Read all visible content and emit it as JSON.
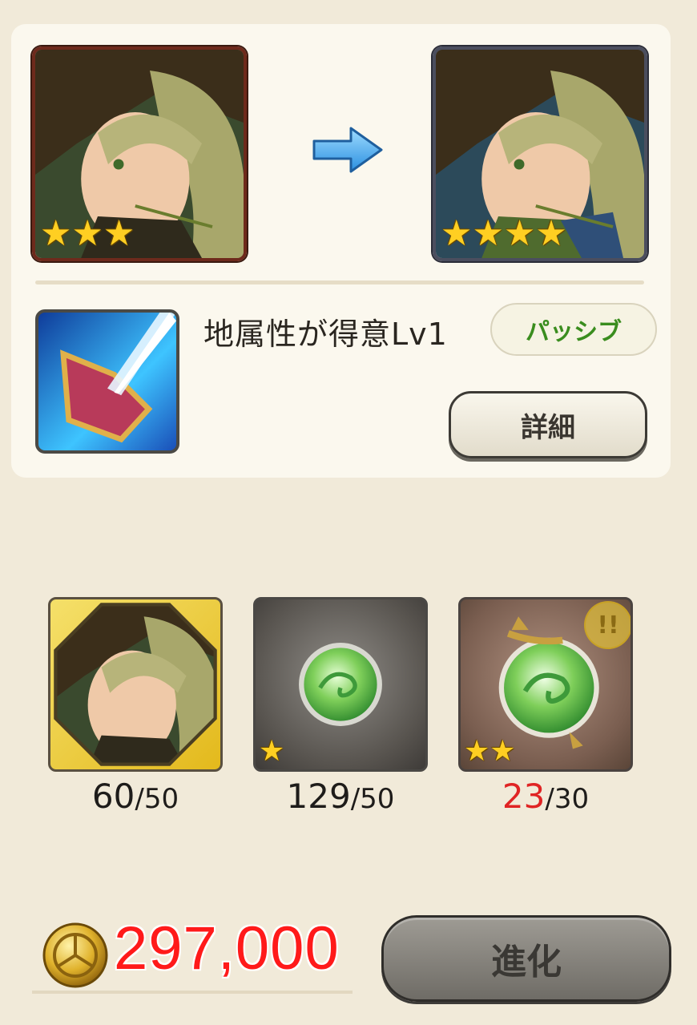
{
  "evolution": {
    "before": {
      "character": "green-haired-witch-portrait",
      "stars": "★★★",
      "rarity": 3
    },
    "after": {
      "character": "green-haired-witch-portrait",
      "stars": "★★★★",
      "rarity": 4
    },
    "arrow_icon": "right-arrow-icon"
  },
  "skill": {
    "icon": "shield-pierce-skill-icon",
    "name": "地属性が得意Lv1",
    "type_label": "パッシブ",
    "detail_button": "詳細"
  },
  "materials": [
    {
      "icon": "character-portrait-octagon",
      "stars": "",
      "have": "60",
      "need": "/50",
      "sufficient": true
    },
    {
      "icon": "green-orb-icon",
      "stars": "★",
      "have": "129",
      "need": "/50",
      "sufficient": true
    },
    {
      "icon": "green-ornate-orb-icon",
      "stars": "★★",
      "have": "23",
      "need": "/30",
      "sufficient": false,
      "badge": "!!"
    }
  ],
  "cost": {
    "icon": "gold-coin-icon",
    "amount": "297,000",
    "color": "#ff1a1a"
  },
  "evolve_button": "進化",
  "colors": {
    "background": "#f1ead9",
    "panel": "#fbf8ee",
    "passive_text": "#3a8d1e",
    "shortage_text": "#e02424"
  }
}
